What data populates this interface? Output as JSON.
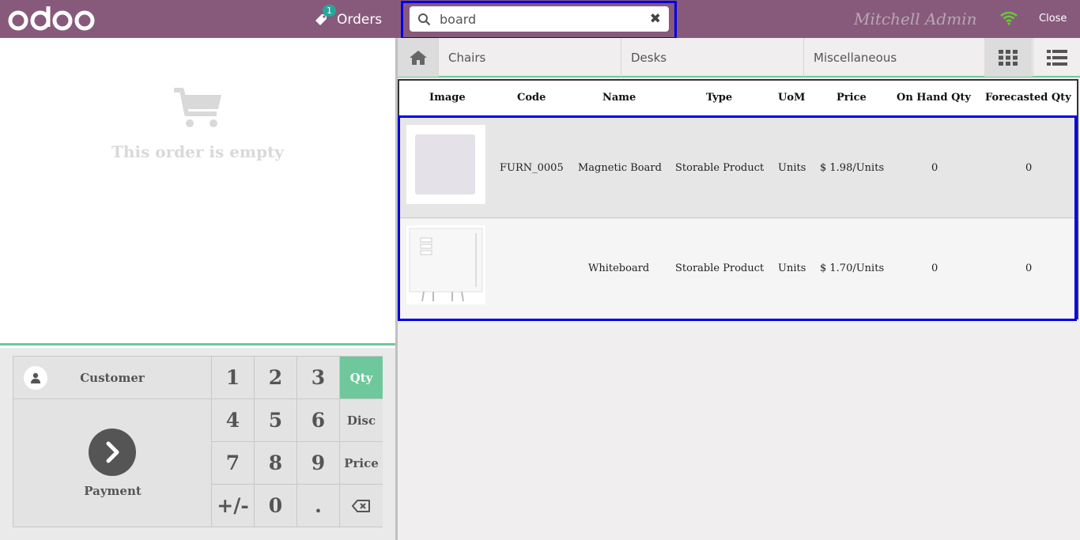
{
  "header": {
    "logo_text": "odoo",
    "orders": {
      "label": "Orders",
      "count": "1"
    },
    "search": {
      "value": "board",
      "placeholder": "Search Products..."
    },
    "cashier": "Mitchell Admin",
    "close_label": "Close"
  },
  "order": {
    "empty_text": "This order is empty"
  },
  "control": {
    "customer_label": "Customer",
    "payment_label": "Payment"
  },
  "numpad": {
    "keys": [
      "1",
      "2",
      "3",
      "Qty",
      "4",
      "5",
      "6",
      "Disc",
      "7",
      "8",
      "9",
      "Price",
      "+/-",
      "0",
      ".",
      ""
    ],
    "active_mode": "Qty"
  },
  "categories": [
    "Chairs",
    "Desks",
    "Miscellaneous"
  ],
  "table": {
    "headers": [
      "Image",
      "Code",
      "Name",
      "Type",
      "UoM",
      "Price",
      "On Hand Qty",
      "Forecasted Qty"
    ],
    "rows": [
      {
        "code": "FURN_0005",
        "name": "Magnetic Board",
        "type": "Storable Product",
        "uom": "Units",
        "price": "$ 1.98/Units",
        "on_hand": "0",
        "forecasted": "0"
      },
      {
        "code": "",
        "name": "Whiteboard",
        "type": "Storable Product",
        "uom": "Units",
        "price": "$ 1.70/Units",
        "on_hand": "0",
        "forecasted": "0"
      }
    ]
  },
  "colors": {
    "brand": "#875a7b",
    "accent": "#6ec89b",
    "highlight": "#0000e6",
    "badge": "#26a69a",
    "wifi": "#66cc33"
  }
}
